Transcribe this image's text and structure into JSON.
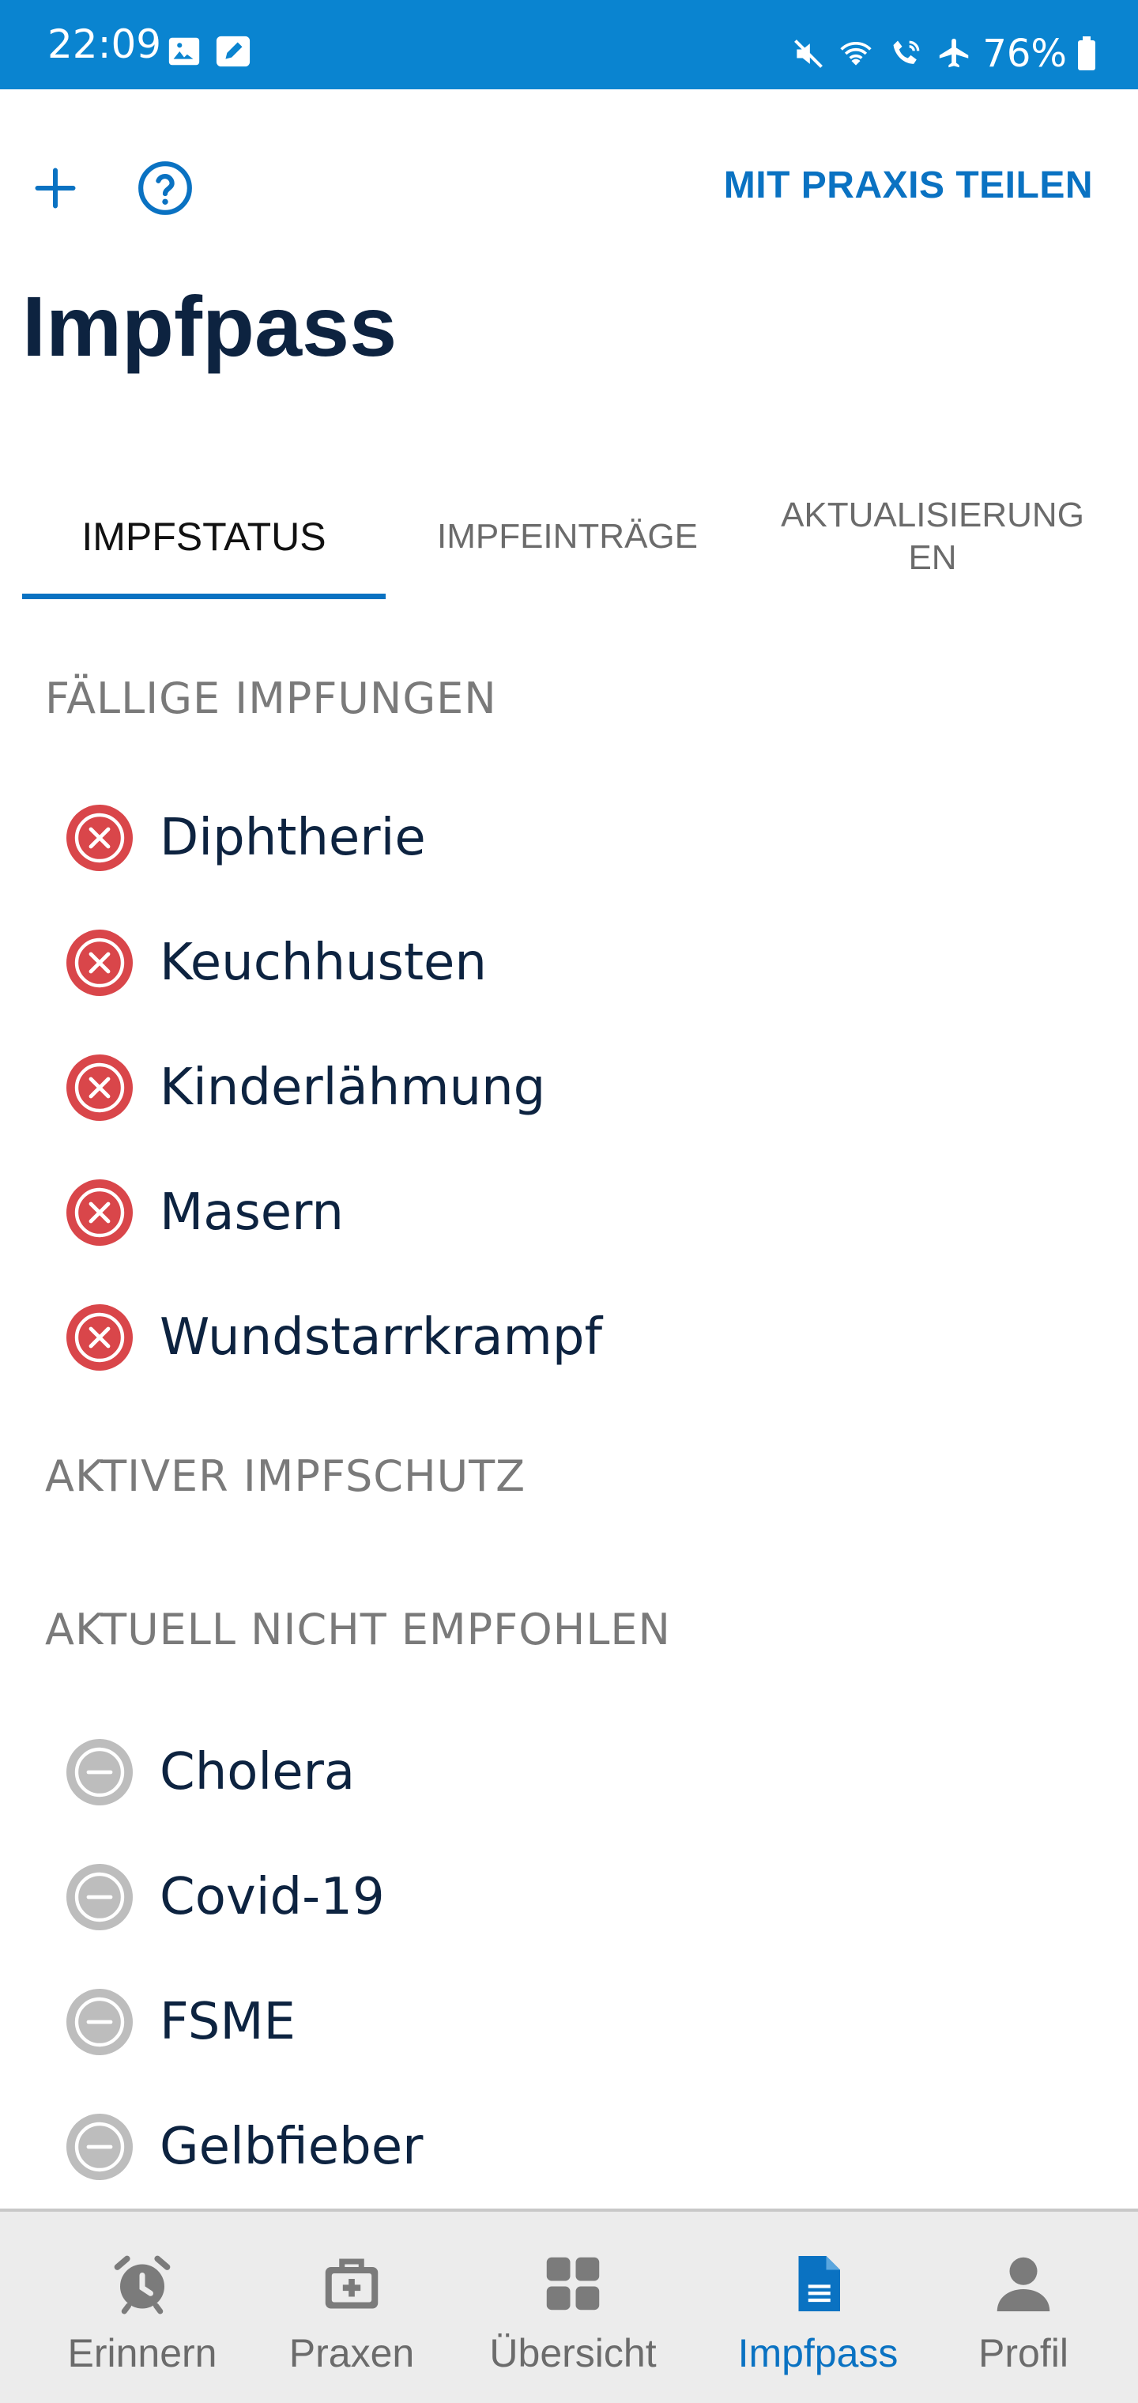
{
  "status_bar": {
    "time": "22:09",
    "battery_pct": "76%",
    "left_icons": [
      "image-icon",
      "edit-icon"
    ],
    "right_icons": [
      "mute-icon",
      "wifi-icon",
      "wifi-call-icon",
      "airplane-icon",
      "battery-icon"
    ]
  },
  "toolbar": {
    "add_icon": "plus-icon",
    "help_icon": "help-icon",
    "share_label": "MIT PRAXIS TEILEN"
  },
  "page_title": "Impfpass",
  "tabs": [
    {
      "label": "IMPFSTATUS",
      "active": true
    },
    {
      "label": "IMPFEINTRÄGE",
      "active": false
    },
    {
      "label": "AKTUALISIERUNG EN",
      "active": false
    }
  ],
  "sections": {
    "due": {
      "heading": "FÄLLIGE IMPFUNGEN",
      "status_icon": "cross-circle-icon",
      "items": [
        "Diphtherie",
        "Keuchhusten",
        "Kinderlähmung",
        "Masern",
        "Wundstarrkrampf"
      ]
    },
    "active": {
      "heading": "AKTIVER IMPFSCHUTZ",
      "items": []
    },
    "not_recommended": {
      "heading": "AKTUELL NICHT EMPFOHLEN",
      "status_icon": "minus-circle-icon",
      "items": [
        "Cholera",
        "Covid-19",
        "FSME",
        "Gelbfieber"
      ]
    }
  },
  "bottom_nav": [
    {
      "label": "Erinnern",
      "icon": "alarm-clock-icon",
      "active": false
    },
    {
      "label": "Praxen",
      "icon": "medical-bag-icon",
      "active": false
    },
    {
      "label": "Übersicht",
      "icon": "dashboard-icon",
      "active": false
    },
    {
      "label": "Impfpass",
      "icon": "document-icon",
      "active": true
    },
    {
      "label": "Profil",
      "icon": "person-icon",
      "active": false
    }
  ],
  "colors": {
    "status_bar": "#0a84d0",
    "accent": "#0a72c2",
    "due_red": "#d9464a",
    "muted_grey": "#b8b8b8",
    "title": "#0d2340"
  }
}
